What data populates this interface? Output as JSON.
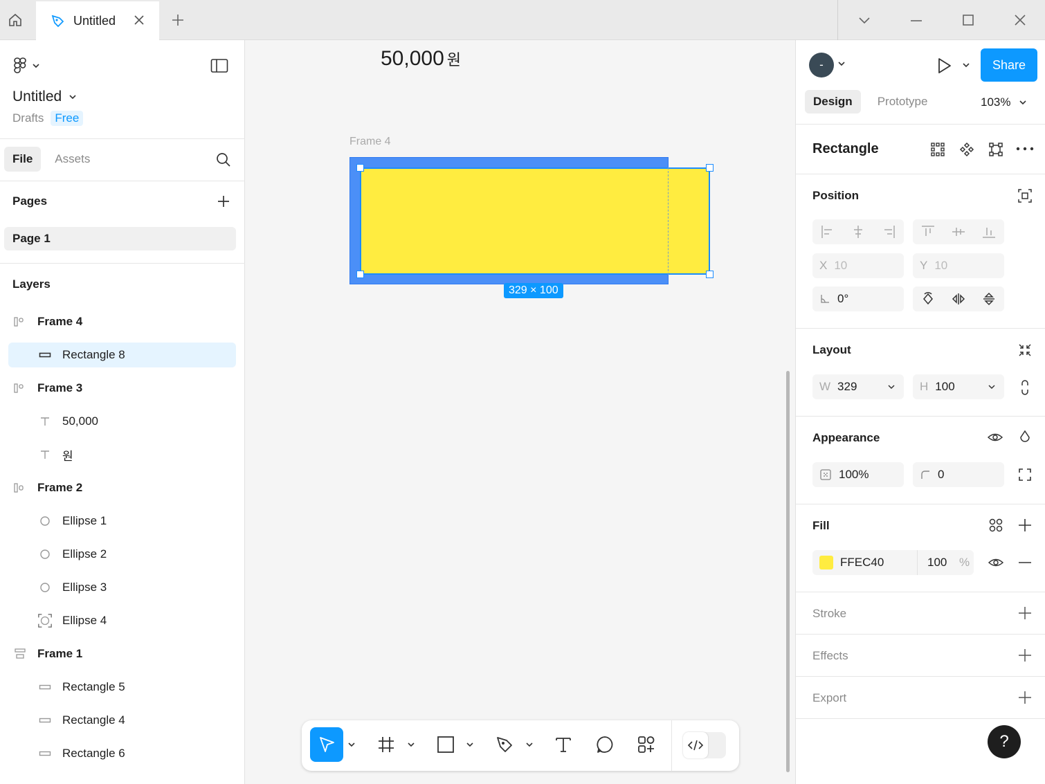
{
  "titlebar": {
    "tab_title": "Untitled"
  },
  "left_panel": {
    "file_title": "Untitled",
    "location": "Drafts",
    "plan_badge": "Free",
    "tabs": {
      "file": "File",
      "assets": "Assets"
    },
    "pages_heading": "Pages",
    "pages": [
      "Page 1"
    ],
    "layers_heading": "Layers",
    "layers": [
      {
        "name": "Frame 4",
        "icon": "frame-icon"
      },
      {
        "name": "Rectangle 8",
        "icon": "rectangle-icon",
        "selected": true
      },
      {
        "name": "Frame 3",
        "icon": "frame-icon"
      },
      {
        "name": "50,000",
        "icon": "text-icon"
      },
      {
        "name": "원",
        "icon": "text-icon"
      },
      {
        "name": "Frame 2",
        "icon": "frame-icon"
      },
      {
        "name": "Ellipse 1",
        "icon": "ellipse-icon"
      },
      {
        "name": "Ellipse 2",
        "icon": "ellipse-icon"
      },
      {
        "name": "Ellipse 3",
        "icon": "ellipse-icon"
      },
      {
        "name": "Ellipse 4",
        "icon": "ellipse-frame-icon"
      },
      {
        "name": "Frame 1",
        "icon": "autolayout-frame-icon"
      },
      {
        "name": "Rectangle 5",
        "icon": "rectangle-icon"
      },
      {
        "name": "Rectangle 4",
        "icon": "rectangle-icon"
      },
      {
        "name": "Rectangle 6",
        "icon": "rectangle-icon"
      }
    ]
  },
  "canvas": {
    "price_value": "50,000",
    "price_unit": "원",
    "frame_label": "Frame 4",
    "size_badge": "329 × 100",
    "fill_color": "#FFEC40",
    "selection_color": "#1B8CFF"
  },
  "right_panel": {
    "avatar_initial": "-",
    "share_label": "Share",
    "tabs": {
      "design": "Design",
      "prototype": "Prototype"
    },
    "zoom": "103%",
    "element_type": "Rectangle",
    "position": {
      "heading": "Position",
      "x_label": "X",
      "x_value": "10",
      "y_label": "Y",
      "y_value": "10",
      "rotation": "0°"
    },
    "layout": {
      "heading": "Layout",
      "w_label": "W",
      "w_value": "329",
      "h_label": "H",
      "h_value": "100"
    },
    "appearance": {
      "heading": "Appearance",
      "opacity": "100%",
      "corner_radius": "0"
    },
    "fill": {
      "heading": "Fill",
      "hex": "FFEC40",
      "opacity": "100",
      "opacity_unit": "%"
    },
    "stroke_heading": "Stroke",
    "effects_heading": "Effects",
    "export_heading": "Export",
    "help_label": "?"
  }
}
